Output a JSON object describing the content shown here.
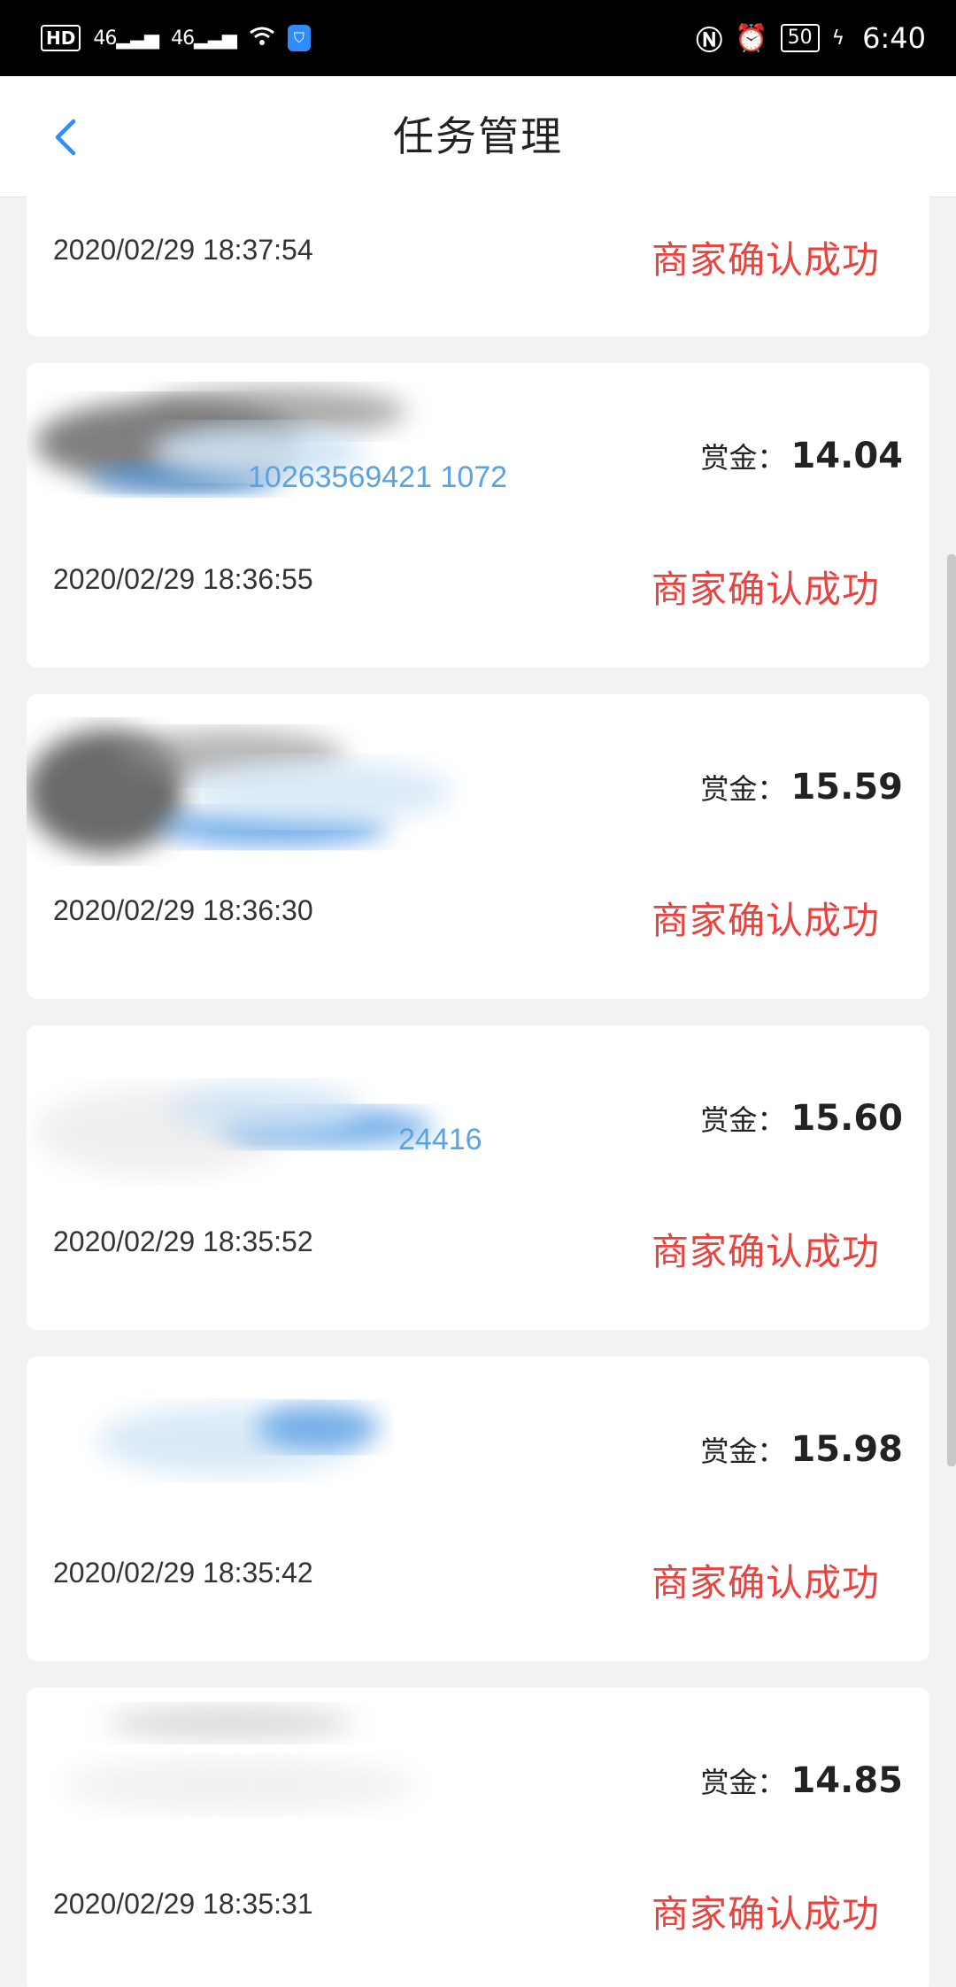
{
  "status_bar": {
    "left": [
      "HD",
      "46",
      "46"
    ],
    "battery": "50",
    "time": "6:40"
  },
  "header": {
    "title": "任务管理"
  },
  "tasks": [
    {
      "time": "2020/02/29 18:37:54",
      "status": "商家确认成功"
    },
    {
      "reward_label": "赏金：",
      "reward": "14.04",
      "masked_id_fragment": "10263569421 1072",
      "time": "2020/02/29 18:36:55",
      "status": "商家确认成功"
    },
    {
      "reward_label": "赏金：",
      "reward": "15.59",
      "time": "2020/02/29 18:36:30",
      "status": "商家确认成功"
    },
    {
      "reward_label": "赏金：",
      "reward": "15.60",
      "masked_id_fragment": "24416",
      "time": "2020/02/29 18:35:52",
      "status": "商家确认成功"
    },
    {
      "reward_label": "赏金：",
      "reward": "15.98",
      "time": "2020/02/29 18:35:42",
      "status": "商家确认成功"
    },
    {
      "reward_label": "赏金：",
      "reward": "14.85",
      "time": "2020/02/29 18:35:31",
      "status": "商家确认成功"
    }
  ],
  "colors": {
    "status_red": "#e8433f",
    "accent_blue": "#2f8cff",
    "background": "#f2f2f2"
  },
  "icons": [
    "back-arrow-icon",
    "nfc-icon",
    "alarm-icon",
    "wifi-icon",
    "shield-icon",
    "battery-icon"
  ]
}
